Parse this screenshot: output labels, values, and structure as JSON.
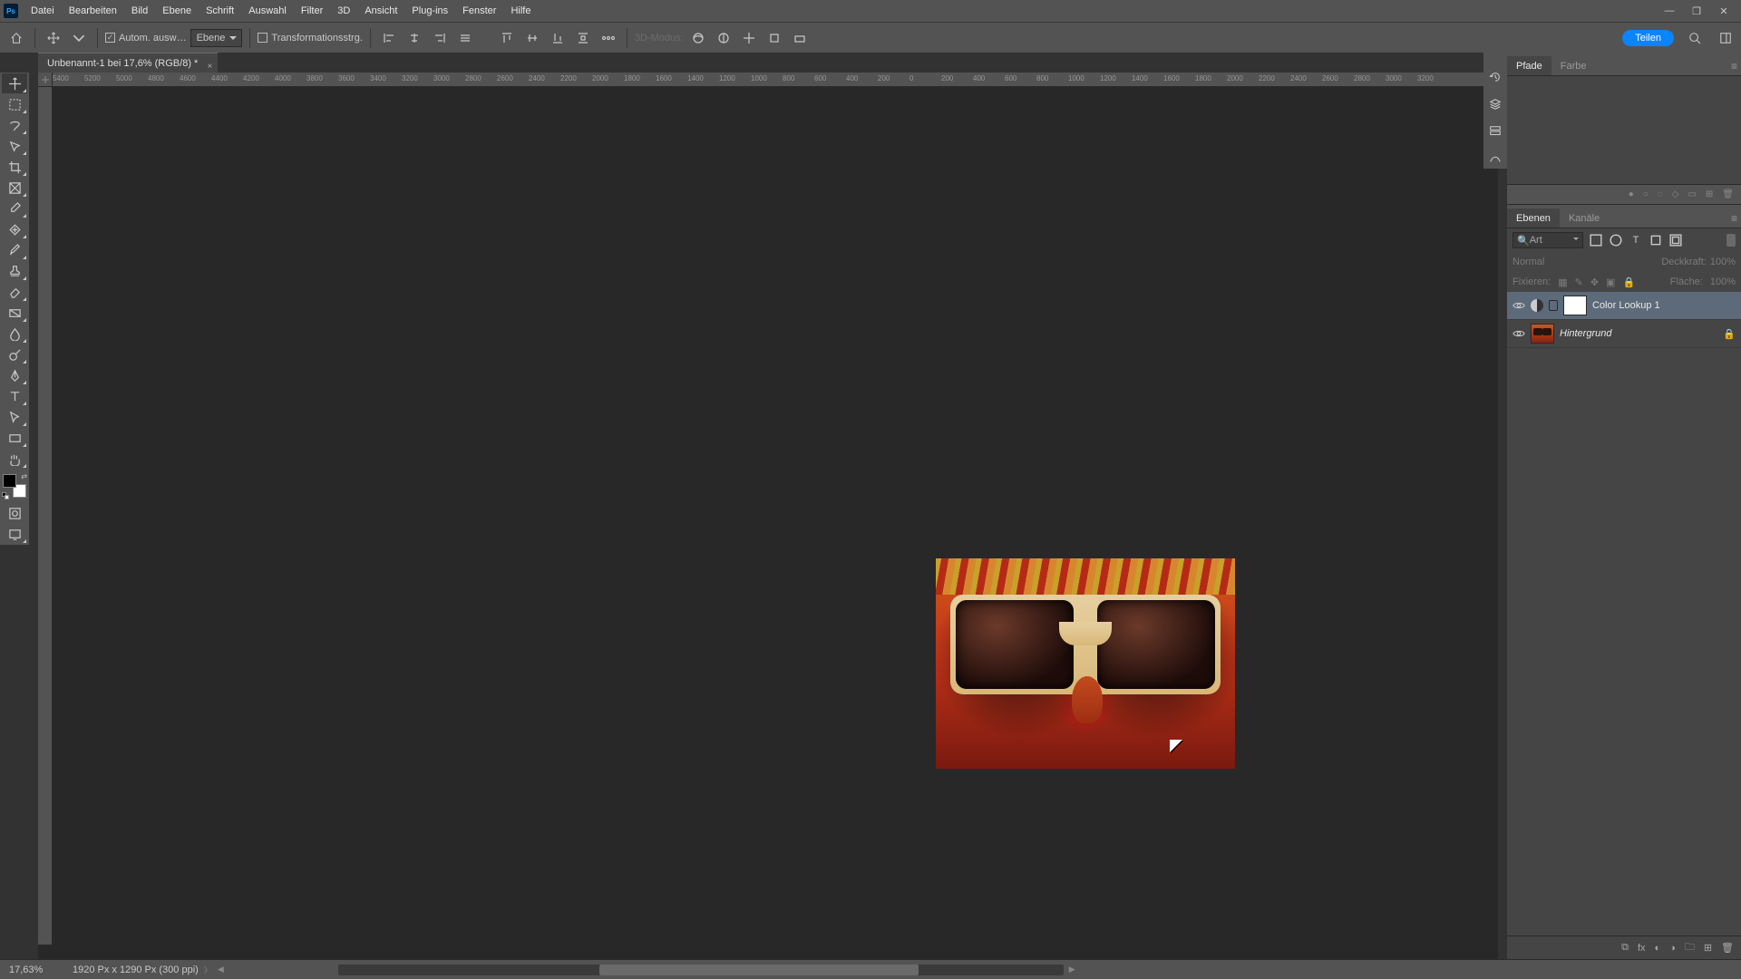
{
  "menu": {
    "items": [
      "Datei",
      "Bearbeiten",
      "Bild",
      "Ebene",
      "Schrift",
      "Auswahl",
      "Filter",
      "3D",
      "Ansicht",
      "Plug-ins",
      "Fenster",
      "Hilfe"
    ]
  },
  "optbar": {
    "auto_select_label": "Autom. ausw…",
    "layer_dropdown": "Ebene",
    "transform_label": "Transformationsstrg.",
    "mode3d_label": "3D-Modus:"
  },
  "share_label": "Teilen",
  "doc": {
    "tab_title": "Unbenannt-1 bei 17,6% (RGB/8) *"
  },
  "ruler_ticks": [
    "5400",
    "5200",
    "5000",
    "4800",
    "4600",
    "4400",
    "4200",
    "4000",
    "3800",
    "3600",
    "3400",
    "3200",
    "3000",
    "2800",
    "2600",
    "2400",
    "2200",
    "2000",
    "1800",
    "1600",
    "1400",
    "1200",
    "1000",
    "800",
    "600",
    "400",
    "200",
    "0",
    "200",
    "400",
    "600",
    "800",
    "1000",
    "1200",
    "1400",
    "1600",
    "1800",
    "2000",
    "2200",
    "2400",
    "2600",
    "2800",
    "3000",
    "3200"
  ],
  "status": {
    "zoom": "17,63%",
    "info": "1920 Px x 1290 Px (300 ppi)"
  },
  "panels": {
    "pfade_tab": "Pfade",
    "farbe_tab": "Farbe",
    "ebenen_tab": "Ebenen",
    "kanale_tab": "Kanäle"
  },
  "layers": {
    "search_kind": "Art",
    "blend_label": "Normal",
    "opacity_label": "Deckkraft:",
    "opacity_value": "100%",
    "lock_label": "Fixieren:",
    "fill_label": "Fläche:",
    "fill_value": "100%",
    "items": [
      {
        "name": "Color Lookup 1",
        "adjustment": true,
        "selected": true
      },
      {
        "name": "Hintergrund",
        "background": true,
        "locked": true
      }
    ]
  }
}
